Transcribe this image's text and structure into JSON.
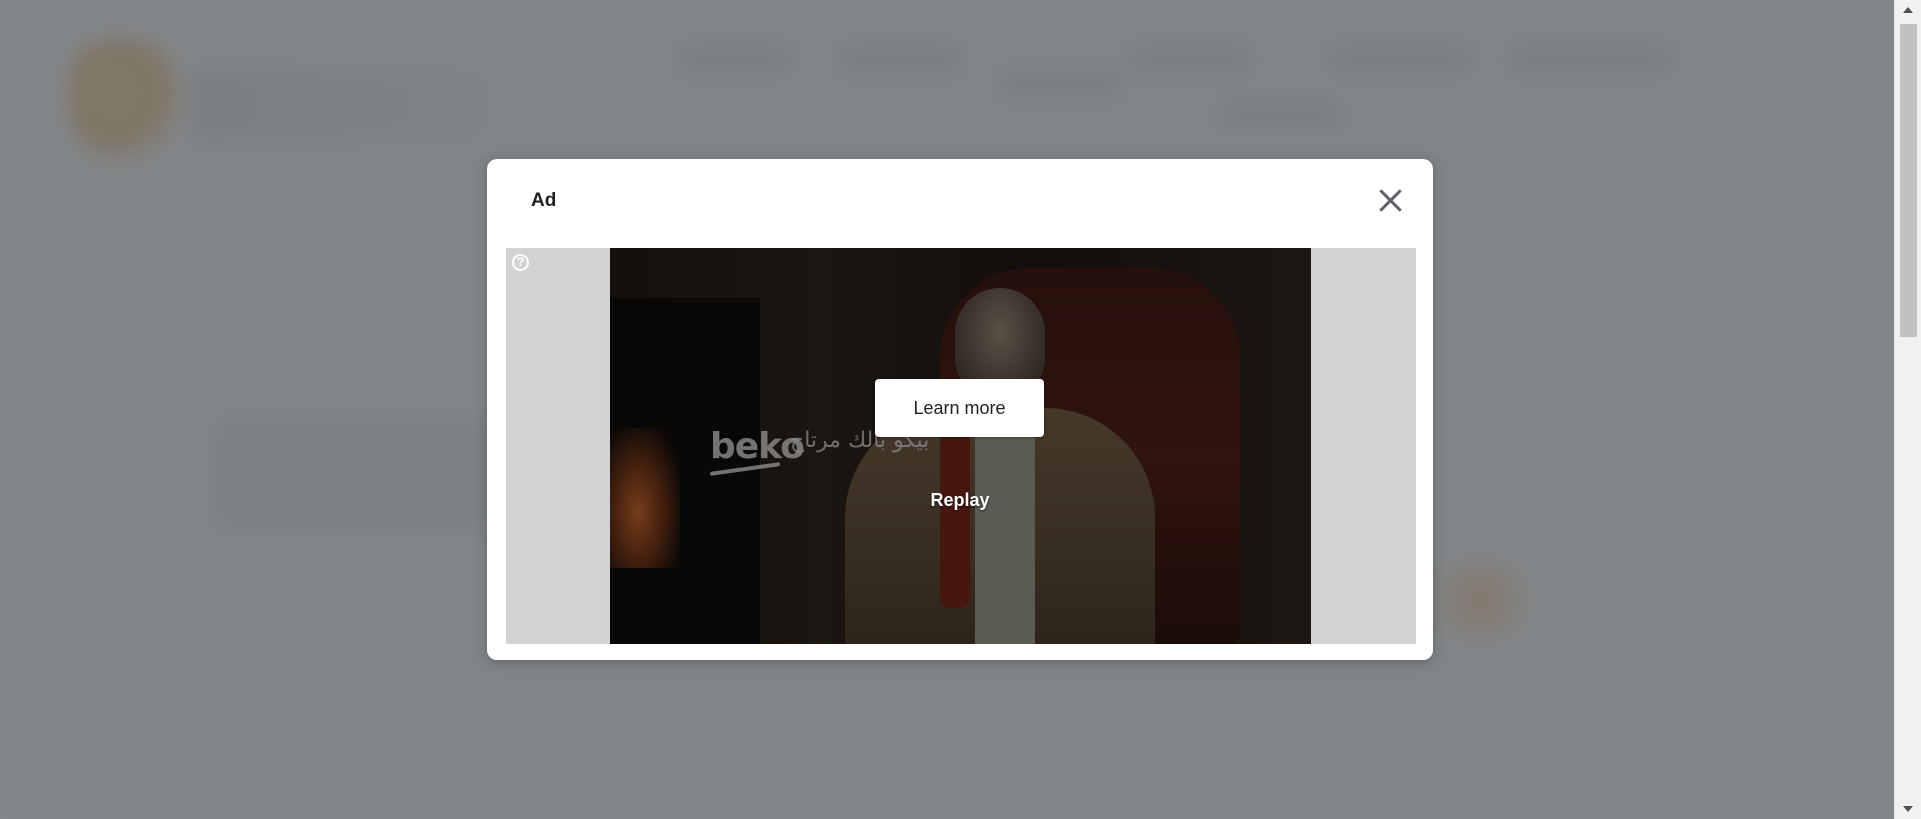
{
  "modal": {
    "label": "Ad",
    "close_icon": "close-icon"
  },
  "ad": {
    "help_icon": "question-circle-icon",
    "help_glyph": "?",
    "brand_name": "beko",
    "brand_tagline": "بيكو بالك مرتاح",
    "learn_more_label": "Learn more",
    "replay_label": "Replay"
  },
  "scrollbar": {
    "up_icon": "scroll-up-arrow-icon",
    "down_icon": "scroll-down-arrow-icon"
  },
  "colors": {
    "overlay": "#696c70",
    "modal_bg": "#ffffff",
    "ad_frame_bg": "#d3d3d3",
    "accent_orange": "#e49a2a"
  }
}
